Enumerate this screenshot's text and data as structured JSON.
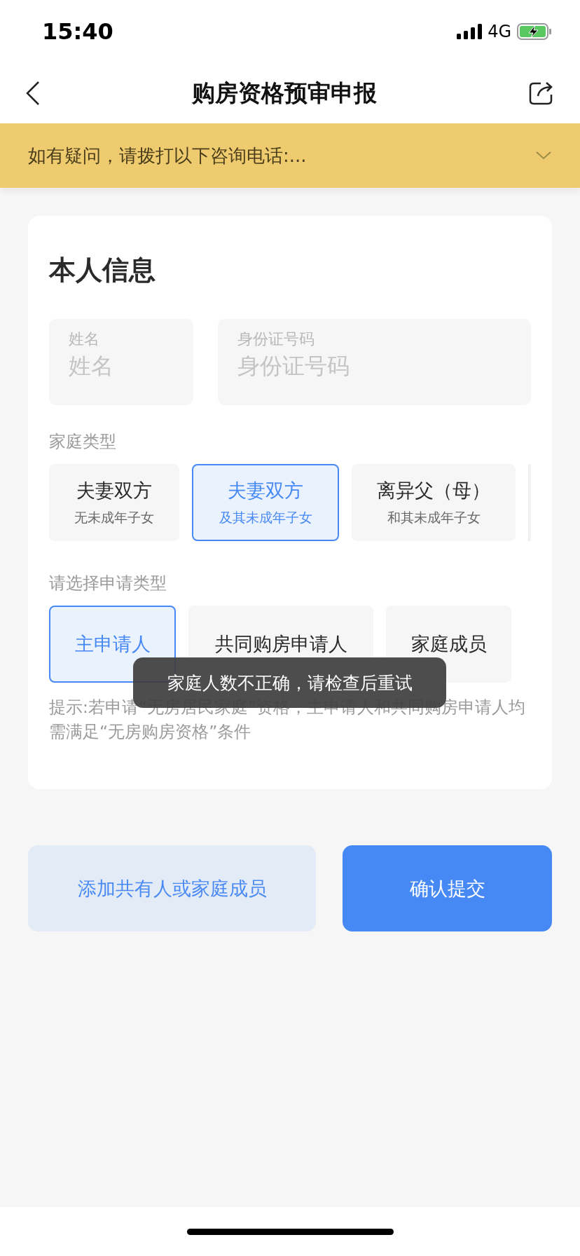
{
  "status_bar": {
    "time": "15:40",
    "network": "4G"
  },
  "nav": {
    "title": "购房资格预审申报"
  },
  "notice": {
    "text": "如有疑问，请拨打以下咨询电话:..."
  },
  "card": {
    "title": "本人信息",
    "fields": [
      {
        "label": "姓名",
        "placeholder": "姓名"
      },
      {
        "label": "身份证号码",
        "placeholder": "身份证号码"
      }
    ],
    "family_type": {
      "label": "家庭类型",
      "options": [
        {
          "title": "夫妻双方",
          "subtitle": "无未成年子女",
          "selected": false
        },
        {
          "title": "夫妻双方",
          "subtitle": "及其未成年子女",
          "selected": true
        },
        {
          "title": "离异父（母）",
          "subtitle": "和其未成年子女",
          "selected": false
        }
      ]
    },
    "apply_type": {
      "label": "请选择申请类型",
      "options": [
        {
          "label": "主申请人",
          "selected": true
        },
        {
          "label": "共同购房申请人",
          "selected": false
        },
        {
          "label": "家庭成员",
          "selected": false
        }
      ]
    },
    "hint": "提示:若申请“无房居民家庭”资格，主申请人和共同购房申请人均需满足“无房购房资格”条件",
    "toast": "家庭人数不正确，请检查后重试"
  },
  "buttons": [
    {
      "kind": "secondary",
      "label": "添加共有人或家庭成员"
    },
    {
      "kind": "primary",
      "label": "确认提交"
    }
  ]
}
